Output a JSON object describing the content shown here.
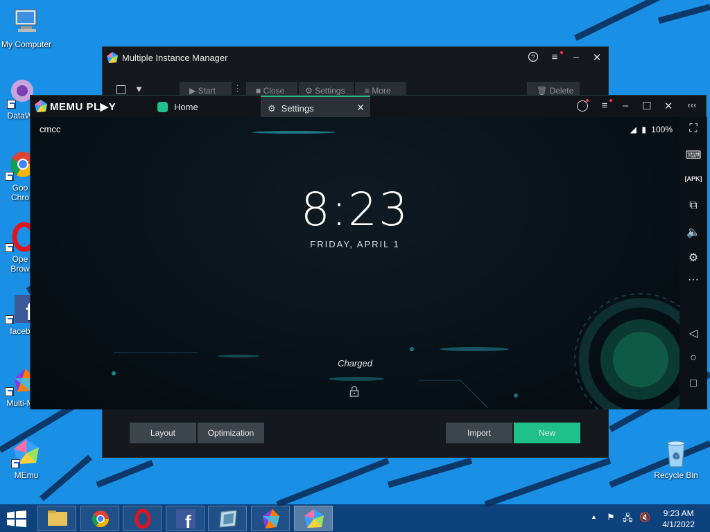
{
  "desktop": {
    "icons": [
      {
        "label": "My Computer",
        "icon": "computer-icon"
      },
      {
        "label": "DataWa",
        "icon": "datawarehouse-icon"
      },
      {
        "label": "Goo\nChro",
        "icon": "chrome-icon"
      },
      {
        "label": "Ope\nBrow",
        "icon": "opera-icon"
      },
      {
        "label": "faceb",
        "icon": "facebook-icon"
      },
      {
        "label": "Multi-M",
        "icon": "multi-memu-icon"
      },
      {
        "label": "MEmu",
        "icon": "memu-icon"
      },
      {
        "label": "Recycle Bin",
        "icon": "recycle-bin-icon"
      }
    ]
  },
  "mim": {
    "title": "Multiple Instance Manager",
    "toolbar": {
      "start": "Start",
      "close": "Close",
      "settings": "Settings",
      "more": "More",
      "delete": "Delete"
    },
    "bottom": {
      "layout": "Layout",
      "optimization": "Optimization",
      "import": "Import",
      "new": "New"
    }
  },
  "memu": {
    "brand": "MEMU PL▶Y",
    "tabs": [
      {
        "label": "Home"
      },
      {
        "label": "Settings"
      }
    ],
    "screen": {
      "carrier": "cmcc",
      "battery": "100%",
      "time": "8:23",
      "date": "FRIDAY, APRIL 1",
      "charged": "Charged"
    }
  },
  "taskbar": {
    "time": "9:23 AM",
    "date": "4/1/2022"
  },
  "colors": {
    "accent_green": "#1fc08a",
    "desktop_blue": "#1a8fe6"
  }
}
